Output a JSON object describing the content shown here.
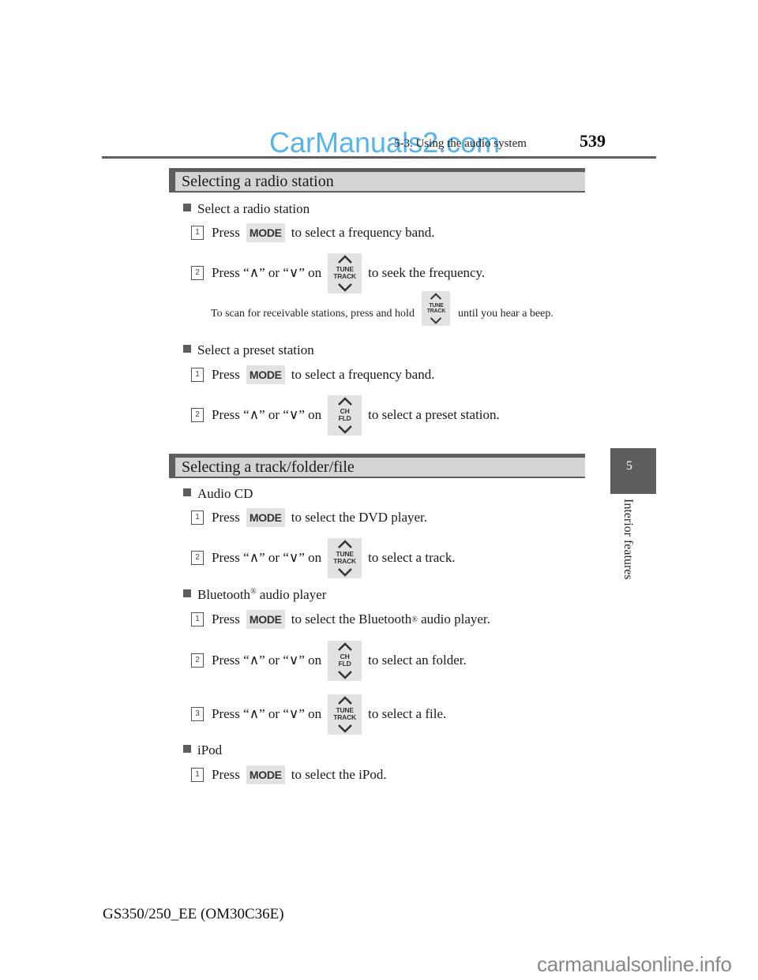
{
  "header": {
    "section": "5-3. Using the audio system",
    "page_number": "539",
    "watermark": "CarManuals2.com"
  },
  "side_tab": {
    "chapter_number": "5",
    "chapter_label": "Interior features"
  },
  "buttons": {
    "mode": "MODE",
    "tune_track_top": "TUNE",
    "tune_track_bottom": "TRACK",
    "ch_fld_top": "CH",
    "ch_fld_bottom": "FLD",
    "up_icon": "chevron-up-icon",
    "down_icon": "chevron-down-icon"
  },
  "sections": [
    {
      "title": "Selecting a radio station",
      "groups": [
        {
          "heading": "Select a radio station",
          "steps": [
            {
              "num": "1",
              "pre": "Press",
              "button": "MODE",
              "post": "to select a frequency band."
            },
            {
              "num": "2",
              "pre": "Press “∧” or “∨” on",
              "button": "TUNE TRACK",
              "post": "to seek the frequency."
            }
          ],
          "note": {
            "pre": "To scan for receivable stations, press and hold",
            "button": "TUNE TRACK",
            "post": "until you hear a beep."
          }
        },
        {
          "heading": "Select a preset station",
          "steps": [
            {
              "num": "1",
              "pre": "Press",
              "button": "MODE",
              "post": "to select a frequency band."
            },
            {
              "num": "2",
              "pre": "Press “∧” or “∨” on",
              "button": "CH FLD",
              "post": "to select a preset station."
            }
          ]
        }
      ]
    },
    {
      "title": "Selecting a track/folder/file",
      "groups": [
        {
          "heading": "Audio CD",
          "steps": [
            {
              "num": "1",
              "pre": "Press",
              "button": "MODE",
              "post": "to select the DVD player."
            },
            {
              "num": "2",
              "pre": "Press “∧” or “∨” on",
              "button": "TUNE TRACK",
              "post": "to select a track."
            }
          ]
        },
        {
          "heading": "Bluetooth",
          "heading_sup": "®",
          "heading_post": " audio player",
          "steps": [
            {
              "num": "1",
              "pre": "Press",
              "button": "MODE",
              "post": "to select the Bluetooth",
              "post_sup": "®",
              "post_tail": " audio player."
            },
            {
              "num": "2",
              "pre": "Press “∧” or “∨” on",
              "button": "CH FLD",
              "post": "to select an folder."
            },
            {
              "num": "3",
              "pre": "Press “∧” or “∨” on",
              "button": "TUNE TRACK",
              "post": "to select a file."
            }
          ]
        },
        {
          "heading": "iPod",
          "steps": [
            {
              "num": "1",
              "pre": "Press",
              "button": "MODE",
              "post": "to select the iPod."
            }
          ]
        }
      ]
    }
  ],
  "footer": {
    "model": "GS350/250_EE (OM30C36E)",
    "watermark": "carmanualsonline.info"
  }
}
